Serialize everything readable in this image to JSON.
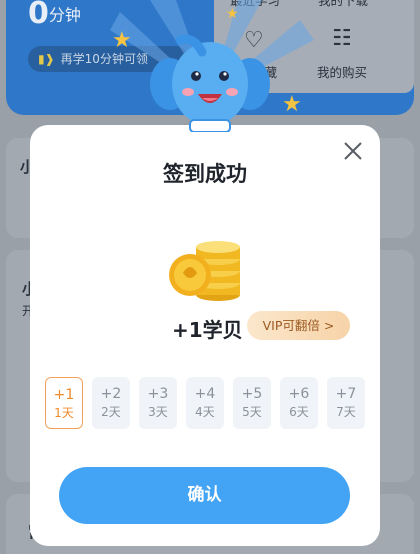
{
  "background": {
    "minutes_value": "0",
    "minutes_unit": "分钟",
    "study_tip": "再学10分钟可领",
    "recent_label": "最近学习",
    "downloads_label": "我的下载",
    "favorites_label": "收藏",
    "purchases_label": "我的购买",
    "section_a_letter": "小",
    "section_b_letter": "小",
    "section_b_sub": "开",
    "section_c_letter": "常"
  },
  "modal": {
    "title": "签到成功",
    "reward": "+1学贝",
    "vip_label": "VIP可翻倍 >",
    "confirm_label": "确认",
    "days": [
      {
        "points": "+1",
        "label": "1天",
        "active": true
      },
      {
        "points": "+2",
        "label": "2天",
        "active": false
      },
      {
        "points": "+3",
        "label": "3天",
        "active": false
      },
      {
        "points": "+4",
        "label": "4天",
        "active": false
      },
      {
        "points": "+5",
        "label": "5天",
        "active": false
      },
      {
        "points": "+6",
        "label": "6天",
        "active": false
      },
      {
        "points": "+7",
        "label": "7天",
        "active": false
      }
    ]
  },
  "colors": {
    "accent": "#43a3f4",
    "active_day": "#f08a2e",
    "vip": "#9a5a22",
    "hero": "#2f78c9"
  },
  "icons": [
    "close-icon",
    "coin-stack-icon",
    "speaker-icon",
    "heart-icon",
    "clipboard-icon",
    "star-icon",
    "elephant-mascot"
  ]
}
